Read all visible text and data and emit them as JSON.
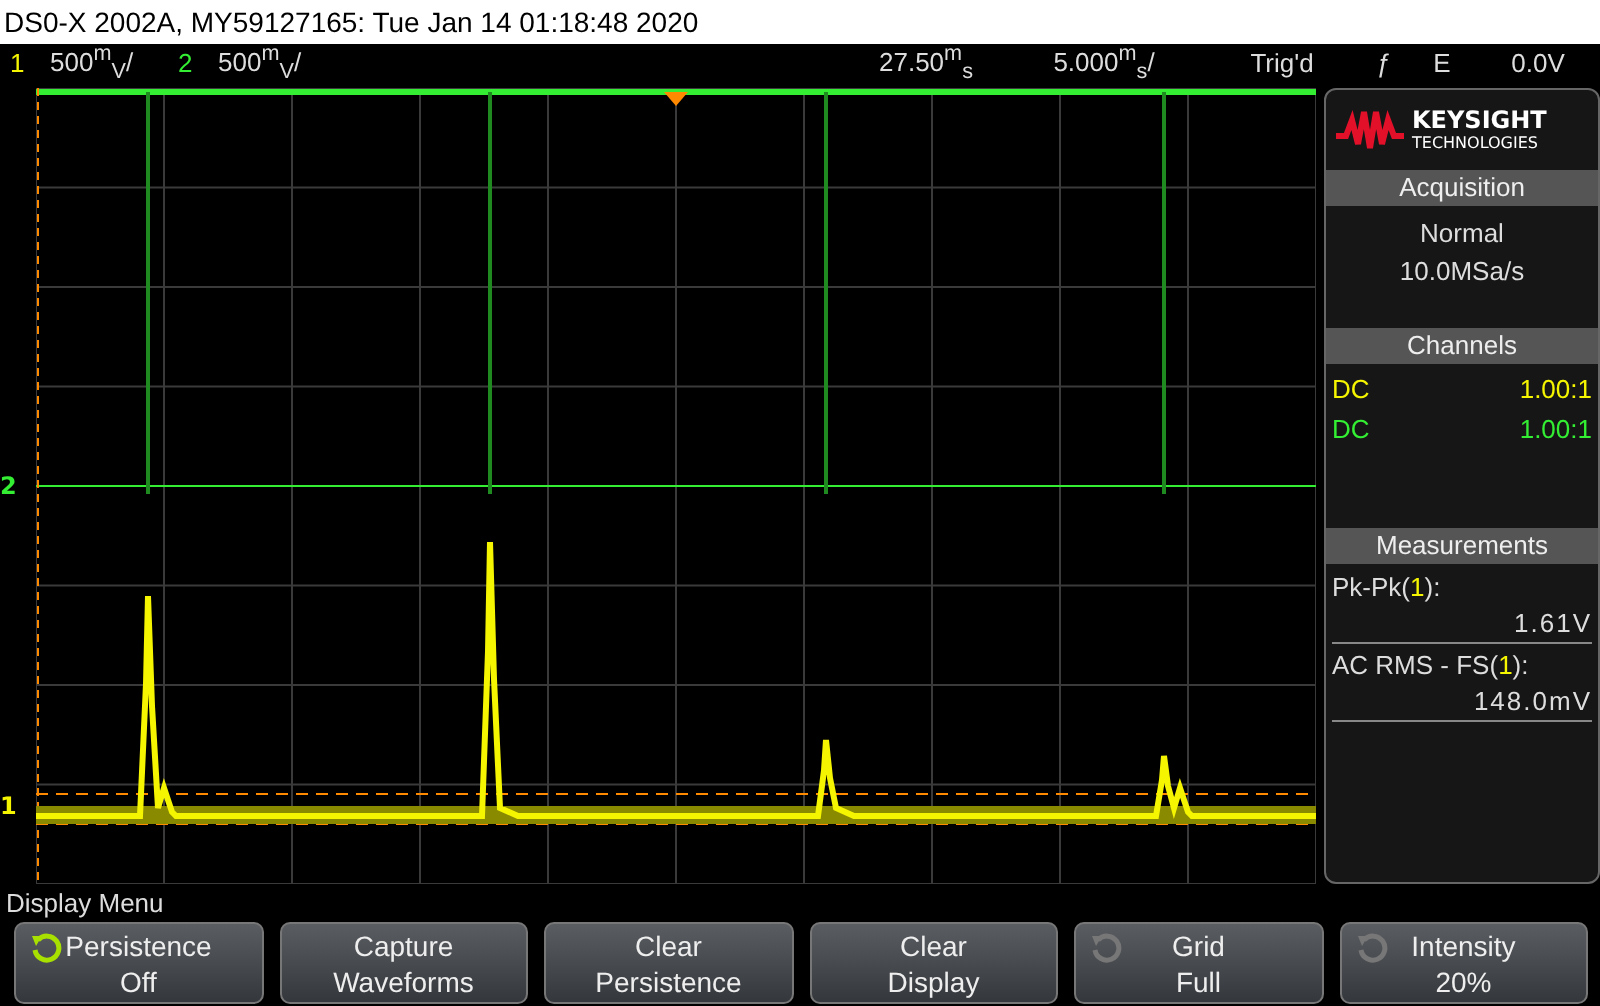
{
  "window": {
    "title": "DS0-X 2002A, MY59127165: Tue Jan 14 01:18:48 2020"
  },
  "status_bar": {
    "channels": [
      {
        "number": "1",
        "scale": "500$^{m}$$_{V}$/",
        "color": "#f5f500"
      },
      {
        "number": "2",
        "scale": "500$^{m}$$_{V}$/",
        "color": "#33ee33"
      }
    ],
    "delay": "27.50$^{m}$$_{s}$",
    "timebase": "5.000$^{m}$$_{s}$/",
    "trigger_state": "Trig'd",
    "trigger_slope_icon": "ƒ",
    "trigger_source": "E",
    "trigger_level": "0.0V"
  },
  "trace_markers": [
    {
      "number": "2",
      "color": "#33ee33"
    },
    {
      "number": "1",
      "color": "#f5f500"
    }
  ],
  "side_panel": {
    "logo": {
      "line1": "KEYSIGHT",
      "line2": "TECHNOLOGIES"
    },
    "acquisition": {
      "title": "Acquisition",
      "mode": "Normal",
      "rate": "10.0MSa/s"
    },
    "channels": {
      "title": "Channels",
      "items": [
        {
          "coupling": "DC",
          "probe": "1.00:1",
          "color": "#f5f500"
        },
        {
          "coupling": "DC",
          "probe": "1.00:1",
          "color": "#33ee33"
        }
      ]
    },
    "measurements": {
      "title": "Measurements",
      "items": [
        {
          "label_parts": [
            "Pk-Pk(",
            "1",
            "):"
          ],
          "value": "1.61V"
        },
        {
          "label_parts": [
            "AC RMS - FS(",
            "1",
            "):"
          ],
          "value": "148.0mV"
        }
      ]
    }
  },
  "menu": {
    "title": "Display Menu",
    "softkeys": [
      {
        "line1": "Persistence",
        "line2": "Off",
        "knob": true,
        "knob_lit": true
      },
      {
        "line1": "Capture",
        "line2": "Waveforms"
      },
      {
        "line1": "Clear",
        "line2": "Persistence"
      },
      {
        "line1": "Clear",
        "line2": "Display"
      },
      {
        "line1": "Grid",
        "line2": "Full",
        "knob": true,
        "knob_lit": false
      },
      {
        "line1": "Intensity",
        "line2": "20%",
        "knob": true,
        "knob_lit": false
      }
    ]
  }
}
